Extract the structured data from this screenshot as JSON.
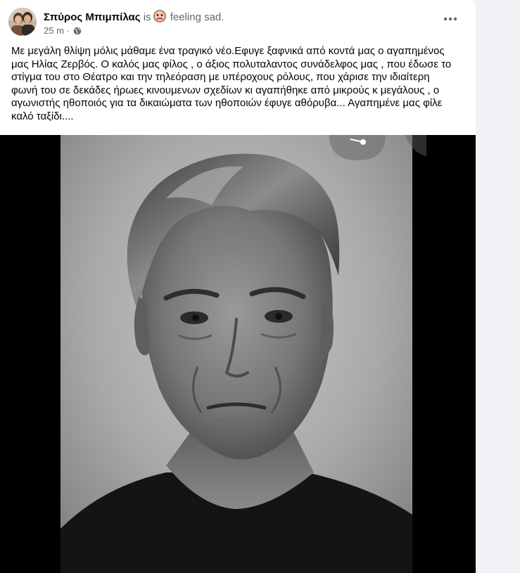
{
  "post": {
    "author": "Σπύρος Μπιμπίλας",
    "is_word": "is",
    "feeling": "feeling sad.",
    "time": "25 m",
    "separator": "·",
    "text_lines": [
      "Με μεγάλη θλίψη μόλις μάθαμε ένα τραγικό νέο.Εφυγε ξαφνικά από κοντά μας ο αγαπημένος",
      "μας Ηλίας Ζερβός. Ο καλός μας φίλος ,  ο άξιος πολυταλαντος συνάδελφος μας , που έδωσε το",
      "στίγμα του στο Θέατρο και  την τηλεόραση με υπέροχους ρόλους,  που χάρισε την ιδιαίτερη",
      "φωνή του σε δεκάδες ήρωες κινουμενων σχεδίων κι αγαπήθηκε από μικρούς κ μεγάλους , ο",
      "αγωνιστής ηθοποιός για τα δικαιώματα των ηθοποιών έφυγε αθόρυβα... Αγαπημένε μας φίλε",
      "καλό ταξίδι...."
    ]
  },
  "icons": {
    "avatar": "profile-photo",
    "feeling": "sad-face-emoji",
    "audience": "globe-icon",
    "more": "more-horizontal-icon",
    "share": "share-icon"
  },
  "colors": {
    "name": "#050505",
    "secondary_text": "#65676b",
    "background": "#f0f2f5",
    "card": "#ffffff",
    "media_background": "#000000"
  }
}
